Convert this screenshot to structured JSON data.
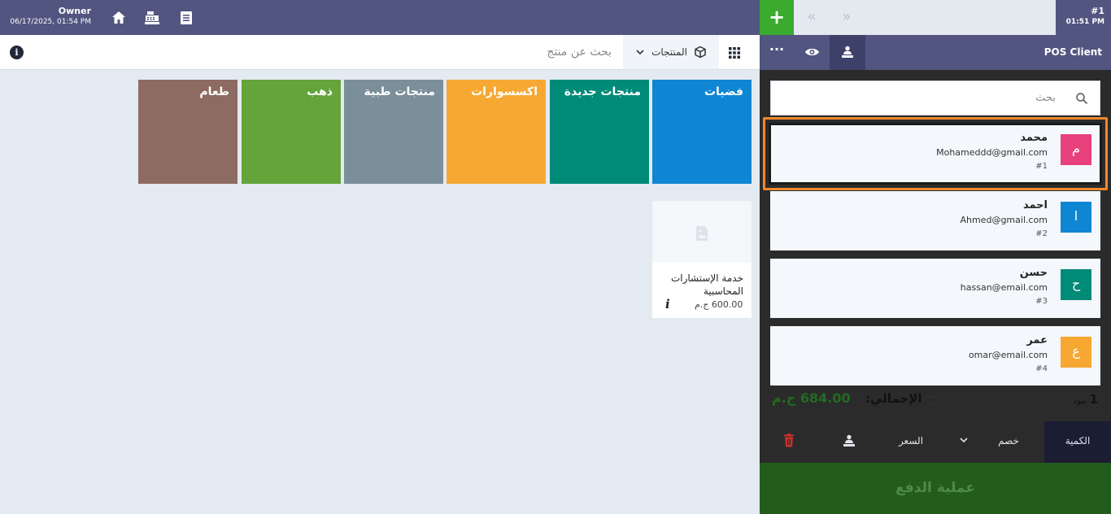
{
  "topbar": {
    "user_name": "Owner",
    "user_datetime": "06/17/2025, 01:54 PM",
    "icons": [
      "home-icon",
      "cash-register-icon",
      "orders-list-icon"
    ]
  },
  "search": {
    "placeholder": "بحث عن منتج",
    "products_dropdown_label": "المنتجات"
  },
  "categories": [
    {
      "label": "فضيات",
      "color": "#0e86d4"
    },
    {
      "label": "منتجات جديدة",
      "color": "#008a78"
    },
    {
      "label": "اكسسوارات",
      "color": "#f6a832"
    },
    {
      "label": "منتجات طبية",
      "color": "#7b8f9a"
    },
    {
      "label": "ذهب",
      "color": "#64a43a"
    },
    {
      "label": "طعام",
      "color": "#8d6b60"
    }
  ],
  "products": [
    {
      "name": "خدمة الإستشارات المحاسبية",
      "price": "600.00 ج.م"
    }
  ],
  "order": {
    "number": "#1",
    "time": "01:51 PM"
  },
  "client_bar": {
    "more_label": "···",
    "label": "POS Client"
  },
  "client_search": {
    "placeholder": "بحث"
  },
  "clients": [
    {
      "initial": "م",
      "name": "محمد",
      "email": "Mohameddd@gmail.com",
      "id": "#1",
      "color": "#e8407a"
    },
    {
      "initial": "ا",
      "name": "احمد",
      "email": "Ahmed@gmail.com",
      "id": "#2",
      "color": "#0e86d4"
    },
    {
      "initial": "ح",
      "name": "حسن",
      "email": "hassan@email.com",
      "id": "#3",
      "color": "#008a78"
    },
    {
      "initial": "ع",
      "name": "عمر",
      "email": "omar@email.com",
      "id": "#4",
      "color": "#f6a832"
    }
  ],
  "summary": {
    "items_count": "1",
    "items_label": "بنود",
    "total_label": "الإجمالي:",
    "total_value": "684.00 ج.م"
  },
  "controls": {
    "quantity": "الكمية",
    "discount": "خصم",
    "price": "السعر"
  },
  "payment": {
    "label": "عملية الدفع"
  }
}
